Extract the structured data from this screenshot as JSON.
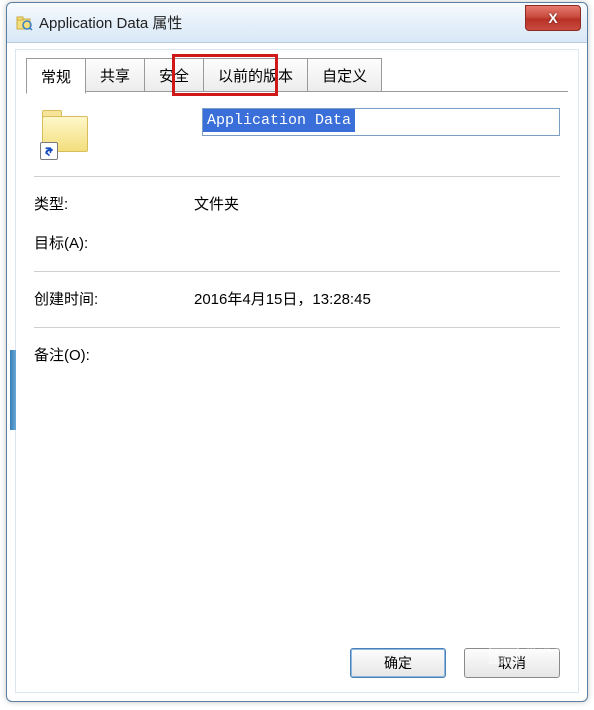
{
  "window": {
    "title": "Application Data 属性",
    "close_label": "X"
  },
  "tabs": [
    {
      "label": "常规",
      "active": true
    },
    {
      "label": "共享",
      "active": false
    },
    {
      "label": "安全",
      "active": false
    },
    {
      "label": "以前的版本",
      "active": false
    },
    {
      "label": "自定义",
      "active": false
    }
  ],
  "highlighted_tab_index": 2,
  "general": {
    "name_value": "Application Data",
    "type_label": "类型:",
    "type_value": "文件夹",
    "target_label": "目标(A):",
    "target_value": "",
    "created_label": "创建时间:",
    "created_value": "2016年4月15日，13:28:45",
    "comment_label": "备注(O):",
    "comment_value": ""
  },
  "buttons": {
    "ok": "确定",
    "cancel": "取消"
  }
}
